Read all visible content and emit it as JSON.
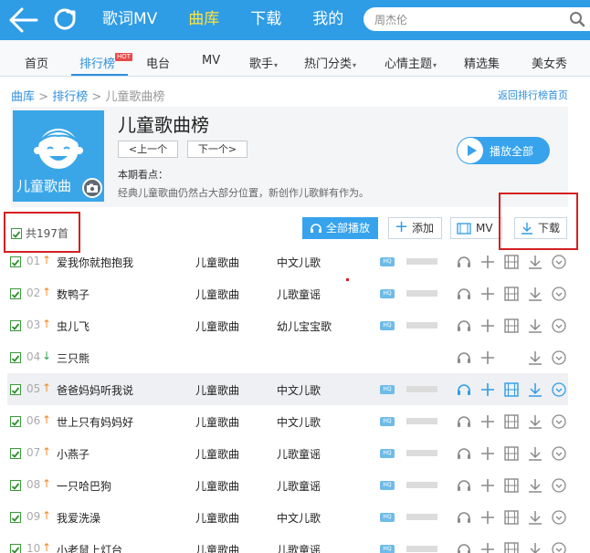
{
  "topbar": {
    "nav": [
      "歌词MV",
      "曲库",
      "下载",
      "我的"
    ],
    "active_index": 1,
    "search_value": "周杰伦",
    "accent": "#2f9ce6",
    "active_color": "#ffe33b",
    "icons": [
      "back-arrow-icon",
      "refresh-icon",
      "search-icon"
    ]
  },
  "subnav": {
    "items": [
      "首页",
      "排行榜",
      "电台",
      "MV",
      "歌手",
      "热门分类",
      "心情主题",
      "精选集",
      "美女秀"
    ],
    "active_index": 1,
    "hot_badge": "HOT"
  },
  "breadcrumb": {
    "root": "曲库",
    "sep1": ">",
    "mid": "排行榜",
    "sep2": ">",
    "current": "儿童歌曲榜"
  },
  "back_link": "返回排行榜首页",
  "chart": {
    "title": "儿童歌曲榜",
    "cover_label": "儿童歌曲",
    "prev_label": "<上一个",
    "next_label": "下一个>",
    "period_label": "本期看点：",
    "description": "经典儿童歌曲仍然占大部分位置，新创作儿歌鲜有作为。",
    "play_all_label": "播放全部"
  },
  "toolbar": {
    "count_label": "共197首",
    "play_all_label": "全部播放",
    "add_label": "添加",
    "mv_label": "MV",
    "download_label": "下载"
  },
  "songs": [
    {
      "num": "01",
      "trend": "up",
      "title": "爱我你就抱抱我",
      "album": "儿童歌曲",
      "genre": "中文儿歌",
      "has_mv": true
    },
    {
      "num": "02",
      "trend": "up",
      "title": "数鸭子",
      "album": "儿童歌曲",
      "genre": "儿歌童谣",
      "has_mv": true
    },
    {
      "num": "03",
      "trend": "up",
      "title": "虫儿飞",
      "album": "儿童歌曲",
      "genre": "幼儿宝宝歌",
      "has_mv": true
    },
    {
      "num": "04",
      "trend": "down",
      "title": "三只熊",
      "album": "",
      "genre": "",
      "has_mv": false
    },
    {
      "num": "05",
      "trend": "up",
      "title": "爸爸妈妈听我说",
      "album": "儿童歌曲",
      "genre": "中文儿歌",
      "has_mv": true
    },
    {
      "num": "06",
      "trend": "up",
      "title": "世上只有妈妈好",
      "album": "儿童歌曲",
      "genre": "中文儿歌",
      "has_mv": true
    },
    {
      "num": "07",
      "trend": "up",
      "title": "小燕子",
      "album": "儿童歌曲",
      "genre": "儿歌童谣",
      "has_mv": true
    },
    {
      "num": "08",
      "trend": "up",
      "title": "一只哈巴狗",
      "album": "儿童歌曲",
      "genre": "儿歌童谣",
      "has_mv": true
    },
    {
      "num": "09",
      "trend": "up",
      "title": "我爱洗澡",
      "album": "儿童歌曲",
      "genre": "中文儿歌",
      "has_mv": true
    },
    {
      "num": "10",
      "trend": "up",
      "title": "小老鼠上灯台",
      "album": "儿童歌曲",
      "genre": "儿歌童谣",
      "has_mv": true
    }
  ],
  "hq_badge": "HQ",
  "highlight_row": 4
}
